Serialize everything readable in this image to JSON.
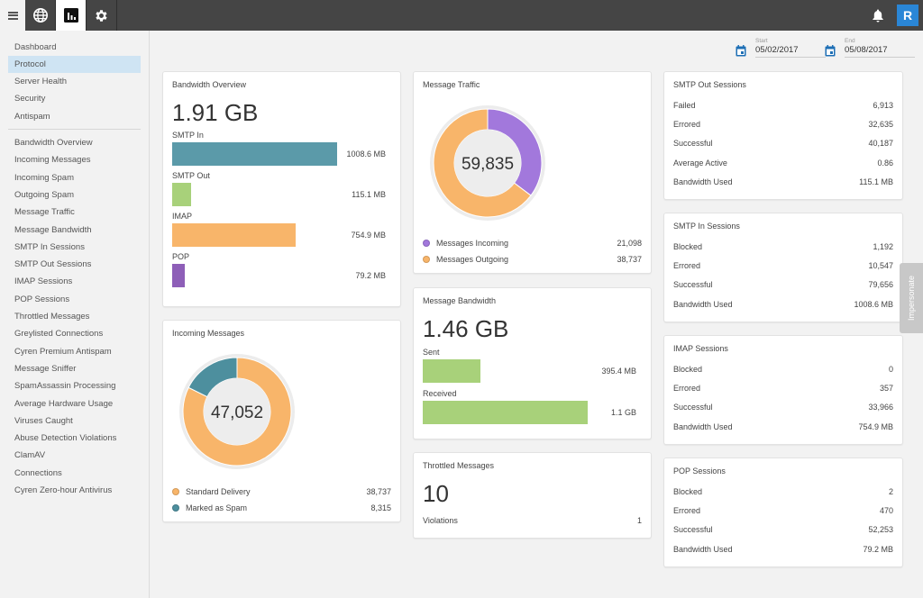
{
  "topbar": {
    "tabs": [
      {
        "icon": "globe-icon",
        "active": false
      },
      {
        "icon": "bar-chart-icon",
        "active": true
      },
      {
        "icon": "gear-icon",
        "active": false
      }
    ],
    "avatar_initial": "R"
  },
  "sidebar": {
    "primary": [
      {
        "label": "Dashboard"
      },
      {
        "label": "Protocol",
        "active": true
      },
      {
        "label": "Server Health"
      },
      {
        "label": "Security"
      },
      {
        "label": "Antispam"
      }
    ],
    "secondary": [
      {
        "label": "Bandwidth Overview"
      },
      {
        "label": "Incoming Messages"
      },
      {
        "label": "Incoming Spam"
      },
      {
        "label": "Outgoing Spam"
      },
      {
        "label": "Message Traffic"
      },
      {
        "label": "Message Bandwidth"
      },
      {
        "label": "SMTP In Sessions"
      },
      {
        "label": "SMTP Out Sessions"
      },
      {
        "label": "IMAP Sessions"
      },
      {
        "label": "POP Sessions"
      },
      {
        "label": "Throttled Messages"
      },
      {
        "label": "Greylisted Connections"
      },
      {
        "label": "Cyren Premium Antispam"
      },
      {
        "label": "Message Sniffer"
      },
      {
        "label": "SpamAssassin Processing"
      },
      {
        "label": "Average Hardware Usage"
      },
      {
        "label": "Viruses Caught"
      },
      {
        "label": "Abuse Detection Violations"
      },
      {
        "label": "ClamAV"
      },
      {
        "label": "Connections"
      },
      {
        "label": "Cyren Zero-hour Antivirus"
      }
    ]
  },
  "dates": {
    "start_label": "Start",
    "start_value": "05/02/2017",
    "end_label": "End",
    "end_value": "05/08/2017"
  },
  "bandwidth_overview": {
    "title": "Bandwidth Overview",
    "total": "1.91 GB",
    "bars": [
      {
        "label": "SMTP In",
        "value": "1008.6 MB",
        "mb": 1008.6,
        "color": "#5b9aa9"
      },
      {
        "label": "SMTP Out",
        "value": "115.1 MB",
        "mb": 115.1,
        "color": "#a8d17a"
      },
      {
        "label": "IMAP",
        "value": "754.9 MB",
        "mb": 754.9,
        "color": "#f8b56a"
      },
      {
        "label": "POP",
        "value": "79.2 MB",
        "mb": 79.2,
        "color": "#8e5fb8"
      }
    ]
  },
  "incoming_messages": {
    "title": "Incoming Messages",
    "total": "47,052",
    "legend": [
      {
        "label": "Standard Delivery",
        "value": "38,737",
        "count": 38737,
        "color": "#f8b56a"
      },
      {
        "label": "Marked as Spam",
        "value": "8,315",
        "count": 8315,
        "color": "#4d8f9e"
      }
    ]
  },
  "message_traffic": {
    "title": "Message Traffic",
    "total": "59,835",
    "legend": [
      {
        "label": "Messages Incoming",
        "value": "21,098",
        "count": 21098,
        "color": "#a278dc"
      },
      {
        "label": "Messages Outgoing",
        "value": "38,737",
        "count": 38737,
        "color": "#f8b56a"
      }
    ]
  },
  "message_bandwidth": {
    "title": "Message Bandwidth",
    "total": "1.46 GB",
    "bars": [
      {
        "label": "Sent",
        "value": "395.4 MB",
        "mb": 395.4,
        "color": "#a8d17a"
      },
      {
        "label": "Received",
        "value": "1.1 GB",
        "mb": 1126.4,
        "color": "#a8d17a"
      }
    ]
  },
  "throttled_messages": {
    "title": "Throttled Messages",
    "total": "10",
    "rows": [
      {
        "label": "Violations",
        "value": "1"
      }
    ]
  },
  "smtp_out": {
    "title": "SMTP Out Sessions",
    "rows": [
      {
        "label": "Failed",
        "value": "6,913"
      },
      {
        "label": "Errored",
        "value": "32,635"
      },
      {
        "label": "Successful",
        "value": "40,187"
      },
      {
        "label": "Average Active",
        "value": "0.86"
      },
      {
        "label": "Bandwidth Used",
        "value": "115.1 MB"
      }
    ]
  },
  "smtp_in": {
    "title": "SMTP In Sessions",
    "rows": [
      {
        "label": "Blocked",
        "value": "1,192"
      },
      {
        "label": "Errored",
        "value": "10,547"
      },
      {
        "label": "Successful",
        "value": "79,656"
      },
      {
        "label": "Bandwidth Used",
        "value": "1008.6 MB"
      }
    ]
  },
  "imap": {
    "title": "IMAP Sessions",
    "rows": [
      {
        "label": "Blocked",
        "value": "0"
      },
      {
        "label": "Errored",
        "value": "357"
      },
      {
        "label": "Successful",
        "value": "33,966"
      },
      {
        "label": "Bandwidth Used",
        "value": "754.9 MB"
      }
    ]
  },
  "pop": {
    "title": "POP Sessions",
    "rows": [
      {
        "label": "Blocked",
        "value": "2"
      },
      {
        "label": "Errored",
        "value": "470"
      },
      {
        "label": "Successful",
        "value": "52,253"
      },
      {
        "label": "Bandwidth Used",
        "value": "79.2 MB"
      }
    ]
  },
  "impersonate_label": "Impersonate"
}
